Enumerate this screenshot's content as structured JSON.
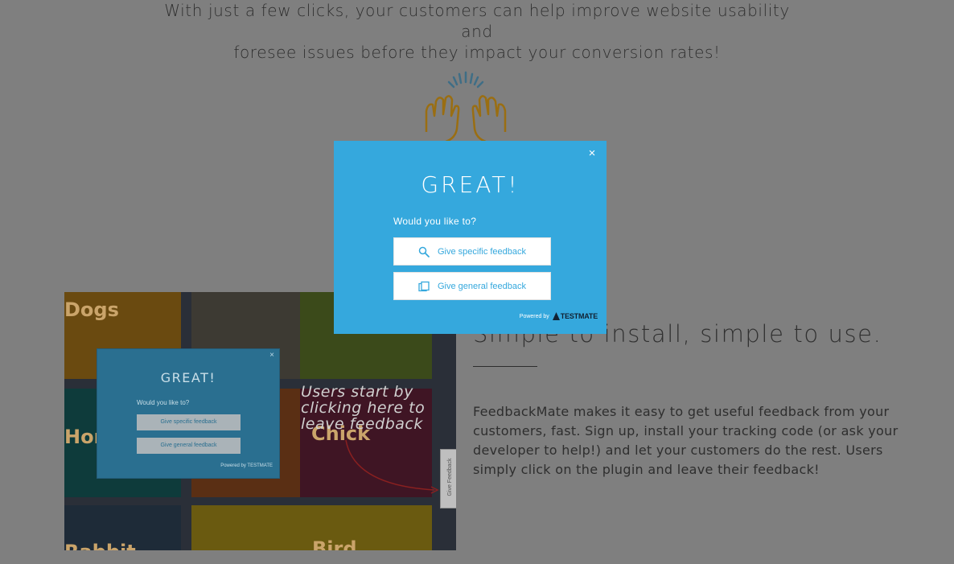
{
  "intro": {
    "line1": "With just a few clicks, your customers can help improve website usability and",
    "line2": "foresee issues before they impact your conversion rates!"
  },
  "screenshot": {
    "tiles": {
      "dogs_title": "Dogs",
      "horse_title": "Hor",
      "rabbit_title": "Rabbit",
      "bird_title": "Bird",
      "chick_title": "Chick"
    },
    "mini_popup": {
      "close": "×",
      "title": "GREAT!",
      "question": "Would you like to?",
      "specific": "Give specific feedback",
      "general": "Give general feedback",
      "powered": "Powered by  TESTMATE"
    },
    "annotation": {
      "line1": "Users start by",
      "line2": "clicking here to",
      "line3": "leave feedback"
    },
    "feedback_tab": "Give Feedback"
  },
  "section": {
    "heading": "Simple to install, simple to use.",
    "body1": "FeedbackMate makes it easy to get useful feedback from your",
    "body2": "customers, fast. Sign up, install your tracking code (or ask your",
    "body3": "developer to help!) and let your customers do the rest. Users",
    "body4": "simply click on the plugin and leave their feedback!"
  },
  "modal": {
    "close": "×",
    "title": "GREAT!",
    "question": "Would you like to?",
    "specific_label": "Give specific feedback",
    "general_label": "Give general feedback",
    "powered_label": "Powered by",
    "brand": "TESTMATE",
    "icons": {
      "specific": "search-icon",
      "general": "pages-icon",
      "brand": "testmate-logo-icon"
    },
    "colors": {
      "background": "#35a8dd",
      "text": "#ffffff",
      "button": "#ffffff"
    }
  },
  "colors": {
    "overlay_bg": "#7f7f7f",
    "hands_icon": "#b8860b"
  }
}
